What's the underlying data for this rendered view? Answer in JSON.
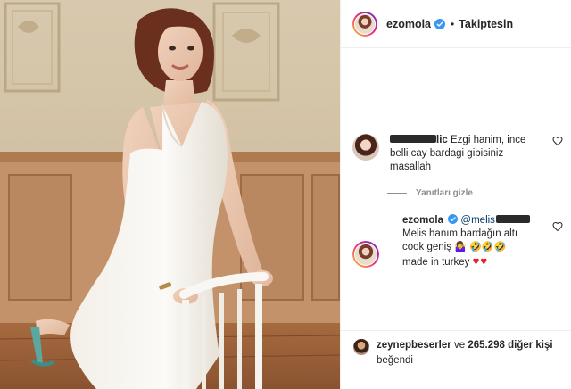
{
  "post": {
    "author": "ezomola",
    "follow_status": "Takiptesin",
    "separator": "•",
    "more": "•••"
  },
  "comments": [
    {
      "username_suffix": "lic",
      "text": "Ezgi hanim, ince belli cay bardagi gibisiniz masallah"
    }
  ],
  "replies_toggle": "Yanıtları gizle",
  "reply": {
    "username": "ezomola",
    "mention": "@melis",
    "text_line1": "Melis hanım bardağın altı",
    "text_line2": "cook geniş",
    "text_line3": "made in turkey",
    "emoji_person": "🤷‍♀️",
    "emoji_laugh": "🤣🤣🤣",
    "emoji_hearts": "♥♥"
  },
  "likes": {
    "user": "zeynepbeserler",
    "conj": "ve",
    "count": "265.298",
    "others": "diğer kişi",
    "verb": "beğendi"
  },
  "colors": {
    "verified_blue": "#3897f0",
    "heart_red": "#ed1c24",
    "muted": "#8e8e8e"
  }
}
